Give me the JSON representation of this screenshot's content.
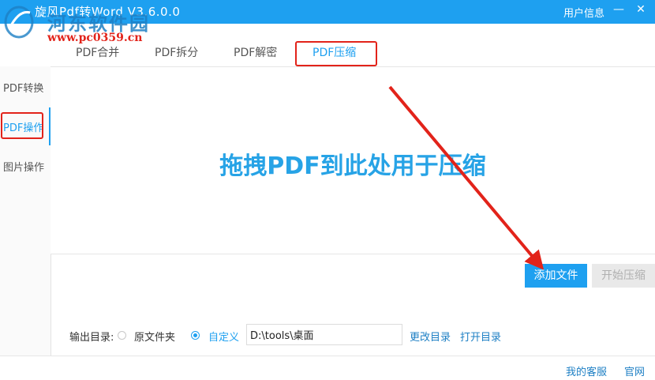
{
  "window": {
    "title": "旋风Pdf转Word V3.6.0.0",
    "user_info": "用户信息",
    "minimize_glyph": "—",
    "close_glyph": "✕"
  },
  "watermark": {
    "title": "河东软件园",
    "url": "www.pc0359.cn"
  },
  "tabs": [
    {
      "label": "PDF合并"
    },
    {
      "label": "PDF拆分"
    },
    {
      "label": "PDF解密"
    },
    {
      "label": "PDF压缩",
      "active": true
    }
  ],
  "sidebar": {
    "items": [
      {
        "label": "PDF转换"
      },
      {
        "label": "PDF操作",
        "active": true
      },
      {
        "label": "图片操作"
      }
    ]
  },
  "drop_zone": {
    "text": "拖拽PDF到此处用于压缩"
  },
  "buttons": {
    "add_file": "添加文件",
    "start_compress": "开始压缩"
  },
  "output": {
    "label": "输出目录:",
    "option_original": "原文件夹",
    "option_custom": "自定义",
    "selected": "custom",
    "path_value": "D:\\tools\\桌面",
    "change_dir": "更改目录",
    "open_dir": "打开目录"
  },
  "footer": {
    "support": "我的客服",
    "website": "官网"
  },
  "colors": {
    "accent": "#1ea0f0",
    "highlight_red": "#e2231a",
    "drop_text": "#27a3e6"
  }
}
